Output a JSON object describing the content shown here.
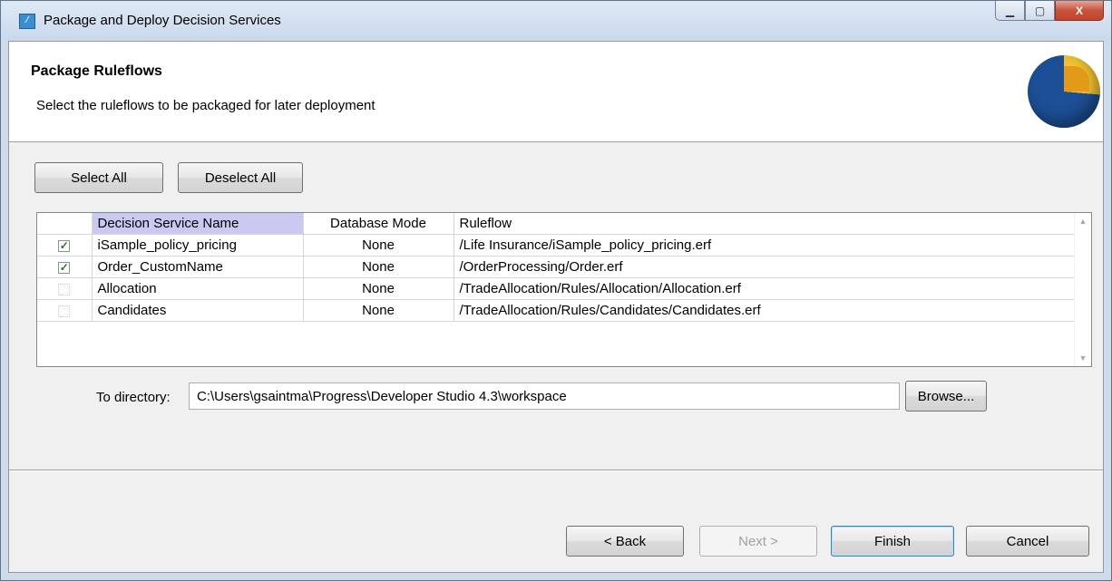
{
  "window": {
    "title": "Package and Deploy Decision Services",
    "controls": {
      "minimize": "▁",
      "maximize": "▢",
      "close": "X"
    }
  },
  "header": {
    "title": "Package Ruleflows",
    "subtitle": "Select the ruleflows to be packaged for later deployment",
    "logo_icon": "pie-logo-icon"
  },
  "toolbar": {
    "select_all": "Select All",
    "deselect_all": "Deselect All"
  },
  "table": {
    "columns": [
      "",
      "Decision Service Name",
      "Database Mode",
      "Ruleflow"
    ],
    "rows": [
      {
        "checked": true,
        "name": "iSample_policy_pricing",
        "mode": "None",
        "ruleflow": "/Life Insurance/iSample_policy_pricing.erf"
      },
      {
        "checked": true,
        "name": "Order_CustomName",
        "mode": "None",
        "ruleflow": "/OrderProcessing/Order.erf"
      },
      {
        "checked": false,
        "name": "Allocation",
        "mode": "None",
        "ruleflow": "/TradeAllocation/Rules/Allocation/Allocation.erf"
      },
      {
        "checked": false,
        "name": "Candidates",
        "mode": "None",
        "ruleflow": "/TradeAllocation/Rules/Candidates/Candidates.erf"
      }
    ]
  },
  "directory": {
    "label": "To directory:",
    "value": "C:\\Users\\gsaintma\\Progress\\Developer Studio 4.3\\workspace",
    "browse": "Browse..."
  },
  "footer": {
    "back": "< Back",
    "next": "Next >",
    "finish": "Finish",
    "cancel": "Cancel"
  },
  "colors": {
    "sorted_header": "#c9c9f2",
    "check": "#1f7a1f",
    "title_bar": "#c9d9ec"
  }
}
